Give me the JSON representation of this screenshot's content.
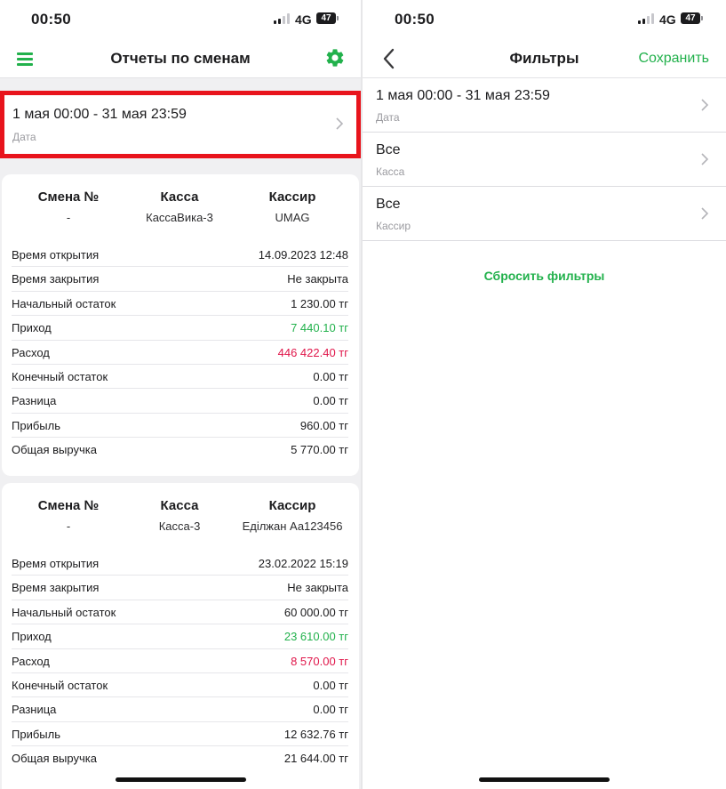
{
  "left_screen": {
    "status": {
      "time": "00:50",
      "network": "4G",
      "battery": "47"
    },
    "header": {
      "title": "Отчеты по сменам",
      "menu_icon": "hamburger-menu-icon",
      "settings_icon": "gear-icon"
    },
    "date_filter": {
      "value": "1 мая 00:00 - 31 мая 23:59",
      "caption": "Дата"
    },
    "shifts": [
      {
        "header": {
          "shift_label": "Смена №",
          "shift_value": "-",
          "register_label": "Касса",
          "register_value": "КассаВика-3",
          "cashier_label": "Кассир",
          "cashier_value": "UMAG"
        },
        "rows": [
          {
            "label": "Время открытия",
            "value": "14.09.2023 12:48"
          },
          {
            "label": "Время закрытия",
            "value": "Не закрыта"
          },
          {
            "label": "Начальный остаток",
            "value": "1 230.00 тг"
          },
          {
            "label": "Приход",
            "value": "7 440.10 тг"
          },
          {
            "label": "Расход",
            "value": "446 422.40 тг"
          },
          {
            "label": "Конечный остаток",
            "value": "0.00 тг"
          },
          {
            "label": "Разница",
            "value": "0.00 тг"
          },
          {
            "label": "Прибыль",
            "value": "960.00 тг"
          },
          {
            "label": "Общая выручка",
            "value": "5 770.00 тг"
          }
        ]
      },
      {
        "header": {
          "shift_label": "Смена №",
          "shift_value": "-",
          "register_label": "Касса",
          "register_value": "Касса-3",
          "cashier_label": "Кассир",
          "cashier_value": "Еділжан Аа123456"
        },
        "rows": [
          {
            "label": "Время открытия",
            "value": "23.02.2022 15:19"
          },
          {
            "label": "Время закрытия",
            "value": "Не закрыта"
          },
          {
            "label": "Начальный остаток",
            "value": "60 000.00 тг"
          },
          {
            "label": "Приход",
            "value": "23 610.00 тг"
          },
          {
            "label": "Расход",
            "value": "8 570.00 тг"
          },
          {
            "label": "Конечный остаток",
            "value": "0.00 тг"
          },
          {
            "label": "Разница",
            "value": "0.00 тг"
          },
          {
            "label": "Прибыль",
            "value": "12 632.76 тг"
          },
          {
            "label": "Общая выручка",
            "value": "21 644.00 тг"
          }
        ]
      }
    ]
  },
  "right_screen": {
    "status": {
      "time": "00:50",
      "network": "4G",
      "battery": "47"
    },
    "header": {
      "title": "Фильтры",
      "save_label": "Сохранить",
      "back_icon": "chevron-left-icon"
    },
    "filters": [
      {
        "value": "1 мая 00:00 - 31 мая 23:59",
        "caption": "Дата"
      },
      {
        "value": "Все",
        "caption": "Касса"
      },
      {
        "value": "Все",
        "caption": "Кассир"
      }
    ],
    "reset_label": "Сбросить фильтры"
  },
  "colors": {
    "accent": "#22b14c",
    "income": "#22b14c",
    "expense": "#e0164a",
    "highlight": "#e8141c"
  }
}
